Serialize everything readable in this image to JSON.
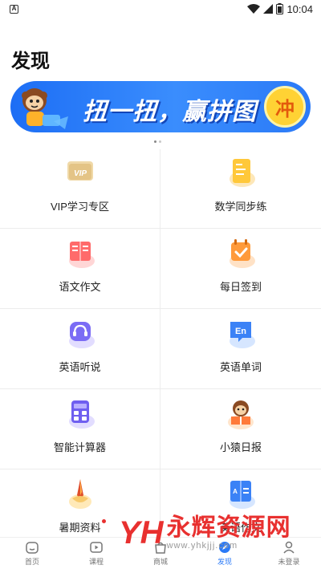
{
  "status_bar": {
    "notification": "A",
    "time": "10:04"
  },
  "page_title": "发现",
  "banner": {
    "text": "扭一扭，赢拼图",
    "button": "冲"
  },
  "grid": [
    {
      "label": "VIP学习专区",
      "icon": "vip-card-icon"
    },
    {
      "label": "数学同步练",
      "icon": "math-practice-icon"
    },
    {
      "label": "语文作文",
      "icon": "chinese-composition-icon"
    },
    {
      "label": "每日签到",
      "icon": "daily-checkin-icon"
    },
    {
      "label": "英语听说",
      "icon": "english-listening-icon"
    },
    {
      "label": "英语单词",
      "icon": "english-words-icon"
    },
    {
      "label": "智能计算器",
      "icon": "calculator-icon"
    },
    {
      "label": "小猿日报",
      "icon": "monkey-daily-icon"
    },
    {
      "label": "暑期资料",
      "icon": "summer-materials-icon"
    },
    {
      "label": "英语作文",
      "icon": "english-composition-icon"
    }
  ],
  "tabbar": [
    {
      "label": "首页",
      "icon": "home-icon"
    },
    {
      "label": "课程",
      "icon": "course-play-icon"
    },
    {
      "label": "商城",
      "icon": "mall-icon"
    },
    {
      "label": "发现",
      "icon": "discover-icon",
      "active": true
    },
    {
      "label": "未登录",
      "icon": "profile-icon"
    }
  ],
  "watermark": {
    "logo": "YH",
    "text": "永辉资源网",
    "url": "www.yhkjjj.com"
  },
  "colors": {
    "accent": "#2b7af7",
    "brand_red": "#e8302f",
    "banner_blue": "#1d6ef5"
  }
}
